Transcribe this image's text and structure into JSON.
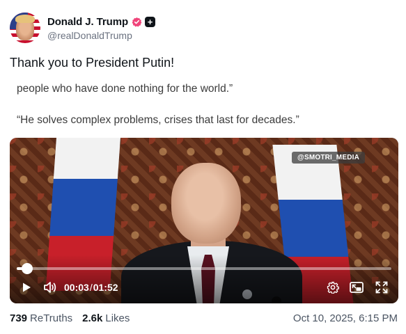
{
  "author": {
    "display_name": "Donald J. Trump",
    "handle": "@realDonaldTrump",
    "verified_color": "#f0447a"
  },
  "post": {
    "text": "Thank you to President Putin!",
    "quote_line_1": "people who have done nothing for the world.”",
    "quote_line_2": "“He solves complex problems, crises that last for decades.”"
  },
  "video": {
    "watermark": "@SMOTRI_MEDIA",
    "current_time": "00:03",
    "time_separator": "/",
    "duration": "01:52",
    "progress_fraction": 0.027
  },
  "stats": {
    "retruths_count": "739",
    "retruths_label": "ReTruths",
    "likes_count": "2.6k",
    "likes_label": "Likes"
  },
  "timestamp": "Oct 10, 2025, 6:15 PM",
  "icons": {
    "verified": "verified-badge-icon",
    "plus": "plus-badge-icon",
    "play": "play-icon",
    "volume": "volume-icon",
    "settings": "gear-icon",
    "pip": "picture-in-picture-icon",
    "fullscreen": "fullscreen-icon"
  }
}
